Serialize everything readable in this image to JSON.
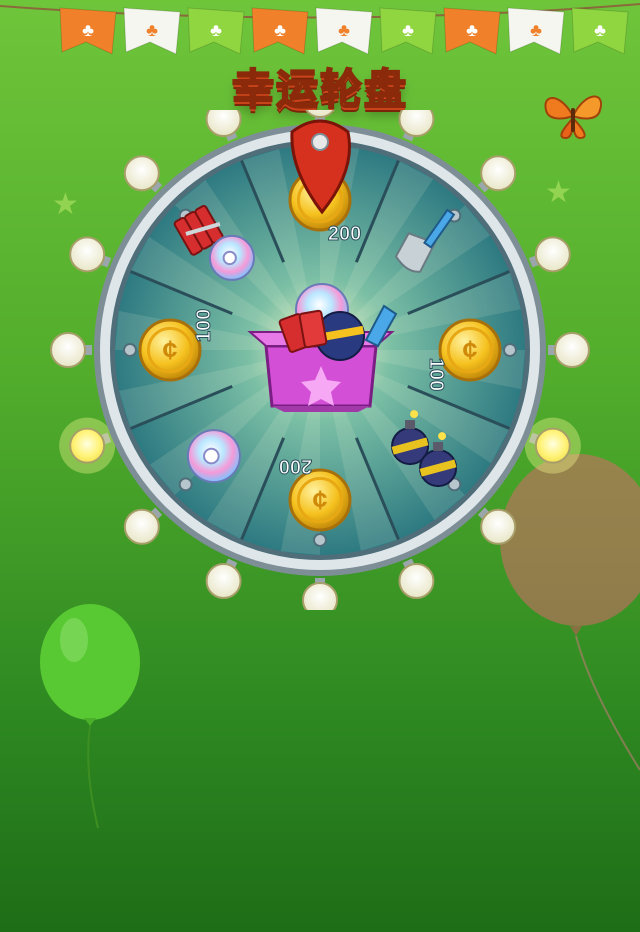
{
  "title": "幸运轮盘",
  "bunting": [
    "orange",
    "white",
    "green",
    "orange",
    "white",
    "green",
    "orange",
    "white",
    "green"
  ],
  "wheel": {
    "segments": [
      {
        "name": "coins",
        "label": "200"
      },
      {
        "name": "shovel",
        "label": ""
      },
      {
        "name": "coins",
        "label": "100"
      },
      {
        "name": "bombs",
        "label": ""
      },
      {
        "name": "coins",
        "label": "200"
      },
      {
        "name": "rainbow-ball",
        "label": ""
      },
      {
        "name": "coins",
        "label": "100"
      },
      {
        "name": "dynamite-and-rainbow-ball",
        "label": ""
      }
    ],
    "center_prize": "mystery-gift-box"
  },
  "colors": {
    "accent": "#ffe14a",
    "pointer": "#d6301e",
    "wheel_rim": "#dfe6ea",
    "wheel_face": "#2f7f86",
    "box": "#d24fd6"
  }
}
